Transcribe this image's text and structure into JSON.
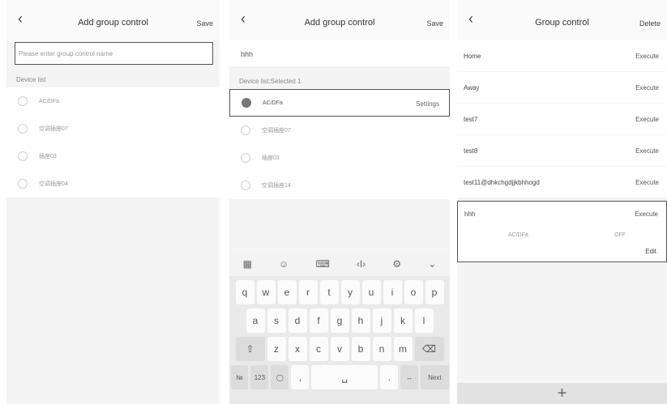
{
  "screen1": {
    "back_icon": "chevron-left-icon",
    "title": "Add group control",
    "save_label": "Save",
    "name_placeholder": "Please enter group control name",
    "device_list_label": "Device list",
    "devices": [
      "AC/DFa",
      "空调插座07",
      "插座03",
      "空调插座04"
    ]
  },
  "screen2": {
    "back_icon": "chevron-left-icon",
    "title": "Add group control",
    "save_label": "Save",
    "name_value": "hhh",
    "device_list_label": "Device list:Selected 1",
    "selected_device": "AC/DFa",
    "settings_label": "Settings",
    "devices": [
      "空调插座07",
      "插座03",
      "空调插座14"
    ],
    "keyboard": {
      "row1": [
        "q",
        "w",
        "e",
        "r",
        "t",
        "y",
        "u",
        "i",
        "o",
        "p"
      ],
      "row2": [
        "a",
        "s",
        "d",
        "f",
        "g",
        "h",
        "j",
        "k",
        "l"
      ],
      "row3": [
        "z",
        "x",
        "c",
        "v",
        "b",
        "n",
        "m"
      ],
      "numbers_label": "123",
      "comma": ",",
      "next_label": "Next"
    }
  },
  "screen3": {
    "back_icon": "chevron-left-icon",
    "title": "Group control",
    "delete_label": "Delete",
    "execute_label": "Execute",
    "groups": [
      "Home",
      "Away",
      "test7",
      "test8",
      "test11@dhkchgdjjkbhhogd"
    ],
    "expanded_group": {
      "name": "hhh",
      "device": "AC/DFa",
      "state": "OFF",
      "edit_label": "Edit"
    },
    "add_icon": "plus-icon"
  }
}
